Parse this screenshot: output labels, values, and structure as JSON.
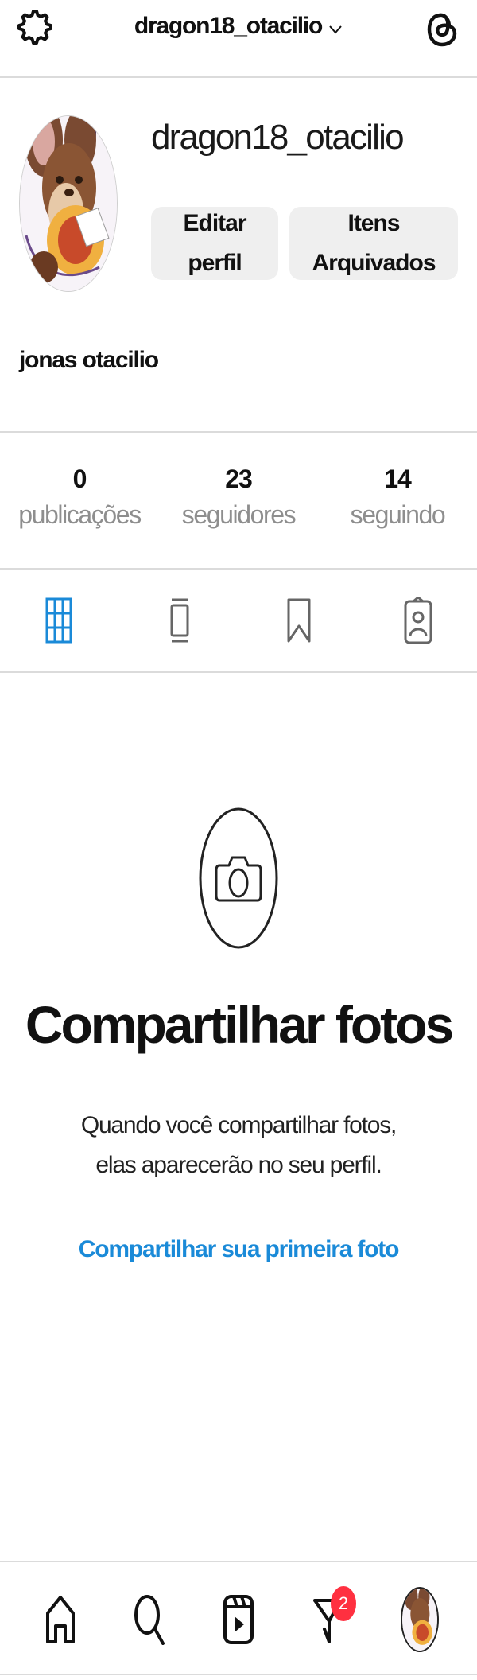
{
  "header": {
    "account_name": "dragon18_otacilio"
  },
  "profile": {
    "username": "dragon18_otacilio",
    "edit_button": "Editar perfil",
    "edit_lines": [
      "Editar",
      "perfil"
    ],
    "archive_lines": [
      "Itens",
      "Arquivados"
    ],
    "full_name": "jonas otacilio"
  },
  "stats": [
    {
      "value": "0",
      "label": "publicações"
    },
    {
      "value": "23",
      "label": "seguidores"
    },
    {
      "value": "14",
      "label": "seguindo"
    }
  ],
  "tabs": [
    {
      "name": "grid",
      "active": true
    },
    {
      "name": "reels",
      "active": false
    },
    {
      "name": "saved",
      "active": false
    },
    {
      "name": "tagged",
      "active": false
    }
  ],
  "empty_state": {
    "title": "Compartilhar fotos",
    "description": "Quando você compartilhar fotos, elas aparecerão no seu perfil.",
    "link": "Compartilhar sua primeira foto"
  },
  "bottom_nav": {
    "notification_count": "2"
  },
  "colors": {
    "accent": "#1a8ad8",
    "badge": "#ff3040",
    "divider": "#dbdbdb",
    "button_bg": "#efefef",
    "muted_text": "#8e8e8e"
  },
  "icons": [
    "settings-icon",
    "chevron-down-icon",
    "threads-icon",
    "grid-icon",
    "reels-icon",
    "bookmark-icon",
    "tagged-icon",
    "camera-icon",
    "home-icon",
    "search-icon",
    "reels-nav-icon",
    "activity-icon",
    "avatar"
  ]
}
